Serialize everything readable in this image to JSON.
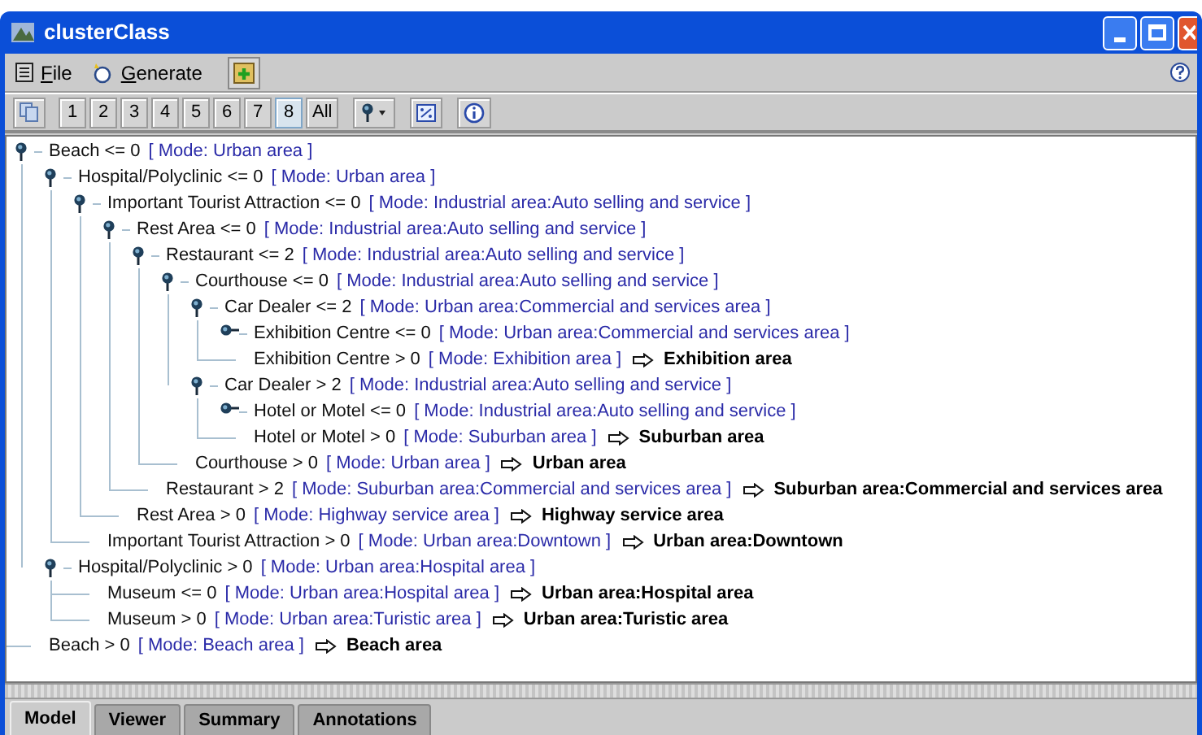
{
  "window": {
    "title": "clusterClass"
  },
  "menu": [
    {
      "label": "File"
    },
    {
      "label": "Generate"
    }
  ],
  "toolbar": {
    "levels": [
      {
        "label": "1",
        "selected": false
      },
      {
        "label": "2",
        "selected": false
      },
      {
        "label": "3",
        "selected": false
      },
      {
        "label": "4",
        "selected": false
      },
      {
        "label": "5",
        "selected": false
      },
      {
        "label": "6",
        "selected": false
      },
      {
        "label": "7",
        "selected": false
      },
      {
        "label": "8",
        "selected": true
      },
      {
        "label": "All",
        "selected": false
      }
    ]
  },
  "tree": [
    {
      "condition": "Beach <= 0",
      "mode": "[ Mode: Urban area ]",
      "expanded": true,
      "children": [
        {
          "condition": "Hospital/Polyclinic <= 0",
          "mode": "[ Mode: Urban area ]",
          "expanded": true,
          "children": [
            {
              "condition": "Important Tourist Attraction <= 0",
              "mode": "[ Mode: Industrial area:Auto selling and service ]",
              "expanded": true,
              "children": [
                {
                  "condition": "Rest Area <= 0",
                  "mode": "[ Mode: Industrial area:Auto selling and service ]",
                  "expanded": true,
                  "children": [
                    {
                      "condition": "Restaurant <= 2",
                      "mode": "[ Mode: Industrial area:Auto selling and service ]",
                      "expanded": true,
                      "children": [
                        {
                          "condition": "Courthouse <= 0",
                          "mode": "[ Mode: Industrial area:Auto selling and service ]",
                          "expanded": true,
                          "children": [
                            {
                              "condition": "Car Dealer <= 2",
                              "mode": "[ Mode: Urban area:Commercial and services area ]",
                              "expanded": true,
                              "children": [
                                {
                                  "condition": "Exhibition Centre <= 0",
                                  "mode": "[ Mode: Urban area:Commercial and services area ]",
                                  "expanded": false
                                },
                                {
                                  "condition": "Exhibition Centre > 0",
                                  "mode": "[ Mode: Exhibition area ]",
                                  "result": "Exhibition area"
                                }
                              ]
                            },
                            {
                              "condition": "Car Dealer > 2",
                              "mode": "[ Mode: Industrial area:Auto selling and service ]",
                              "expanded": true,
                              "children": [
                                {
                                  "condition": "Hotel or Motel <= 0",
                                  "mode": "[ Mode: Industrial area:Auto selling and service ]",
                                  "expanded": false
                                },
                                {
                                  "condition": "Hotel or Motel > 0",
                                  "mode": "[ Mode: Suburban area ]",
                                  "result": "Suburban area"
                                }
                              ]
                            }
                          ]
                        },
                        {
                          "condition": "Courthouse > 0",
                          "mode": "[ Mode: Urban area ]",
                          "result": "Urban area"
                        }
                      ]
                    },
                    {
                      "condition": "Restaurant > 2",
                      "mode": "[ Mode: Suburban area:Commercial and services area ]",
                      "result": "Suburban area:Commercial and services area"
                    }
                  ]
                },
                {
                  "condition": "Rest Area > 0",
                  "mode": "[ Mode: Highway service area ]",
                  "result": "Highway service area"
                }
              ]
            },
            {
              "condition": "Important Tourist Attraction > 0",
              "mode": "[ Mode: Urban area:Downtown ]",
              "result": "Urban area:Downtown"
            }
          ]
        },
        {
          "condition": "Hospital/Polyclinic > 0",
          "mode": "[ Mode: Urban area:Hospital area ]",
          "expanded": true,
          "children": [
            {
              "condition": "Museum <= 0",
              "mode": "[ Mode: Urban area:Hospital area ]",
              "result": "Urban area:Hospital area"
            },
            {
              "condition": "Museum > 0",
              "mode": "[ Mode: Urban area:Turistic area ]",
              "result": "Urban area:Turistic area"
            }
          ]
        }
      ]
    },
    {
      "condition": "Beach > 0",
      "mode": "[ Mode: Beach area ]",
      "result": "Beach area"
    }
  ],
  "tabs": [
    {
      "label": "Model",
      "selected": true
    },
    {
      "label": "Viewer",
      "selected": false
    },
    {
      "label": "Summary",
      "selected": false
    },
    {
      "label": "Annotations",
      "selected": false
    }
  ]
}
